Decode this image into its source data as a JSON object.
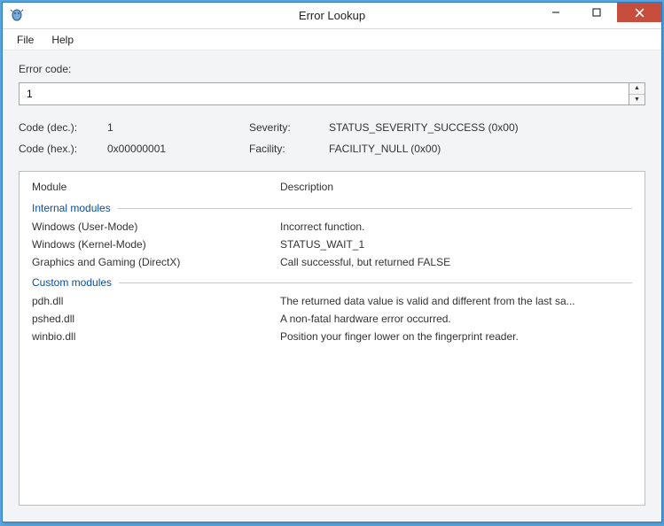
{
  "window": {
    "title": "Error Lookup"
  },
  "menu": {
    "file": "File",
    "help": "Help"
  },
  "input": {
    "label": "Error code:",
    "value": "1"
  },
  "info": {
    "code_dec_label": "Code (dec.):",
    "code_dec_value": "1",
    "severity_label": "Severity:",
    "severity_value": "STATUS_SEVERITY_SUCCESS (0x00)",
    "code_hex_label": "Code (hex.):",
    "code_hex_value": "0x00000001",
    "facility_label": "Facility:",
    "facility_value": "FACILITY_NULL (0x00)"
  },
  "results": {
    "header_module": "Module",
    "header_description": "Description",
    "section_internal": "Internal modules",
    "section_custom": "Custom modules",
    "internal": [
      {
        "module": "Windows (User-Mode)",
        "desc": "Incorrect function."
      },
      {
        "module": "Windows (Kernel-Mode)",
        "desc": "STATUS_WAIT_1"
      },
      {
        "module": "Graphics and Gaming (DirectX)",
        "desc": "Call successful, but returned FALSE"
      }
    ],
    "custom": [
      {
        "module": "pdh.dll",
        "desc": "The returned data value is valid and different from the last sa..."
      },
      {
        "module": "pshed.dll",
        "desc": "A non-fatal hardware error occurred."
      },
      {
        "module": "winbio.dll",
        "desc": "Position your finger lower on the fingerprint reader."
      }
    ]
  }
}
